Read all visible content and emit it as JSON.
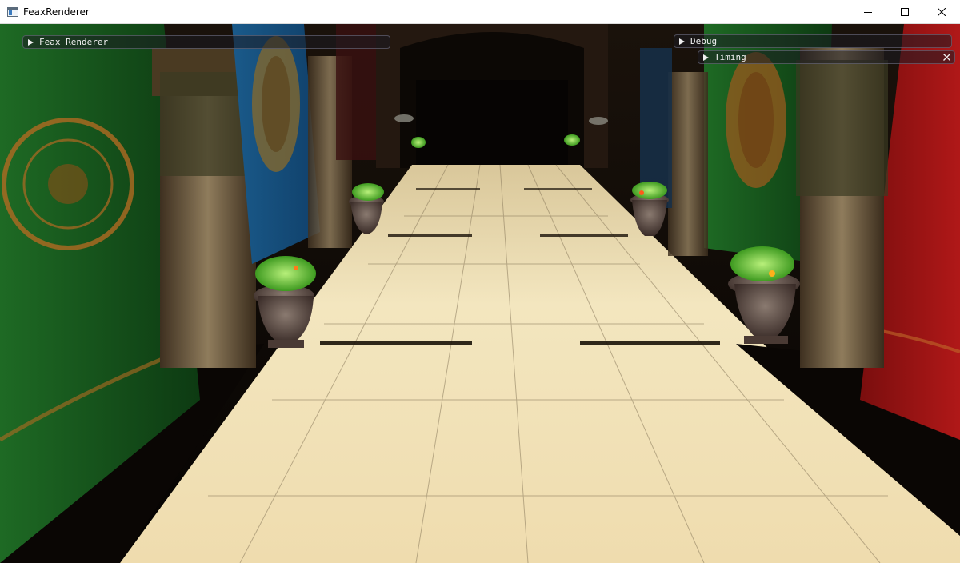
{
  "window": {
    "title": "FeaxRenderer",
    "icon": "app-window-icon",
    "controls": {
      "minimize": "minimize-icon",
      "maximize": "maximize-icon",
      "close": "close-icon"
    }
  },
  "overlay": {
    "main_panel": {
      "label": "Feax Renderer",
      "expanded": false
    },
    "debug_panel": {
      "label": "Debug",
      "expanded": false
    },
    "timing_panel": {
      "label": "Timing",
      "expanded": false,
      "close_icon": "close-icon"
    }
  },
  "colors": {
    "titlebar_bg": "#ffffff",
    "panel_bg": "#1c1c22",
    "panel_text": "#f0f0f0",
    "floor": "#e9d7a8",
    "curtain_green": "#1a5a1e",
    "curtain_blue": "#1f5f8e",
    "curtain_red": "#9a1212",
    "pillar_stone": "#7a6a50"
  }
}
